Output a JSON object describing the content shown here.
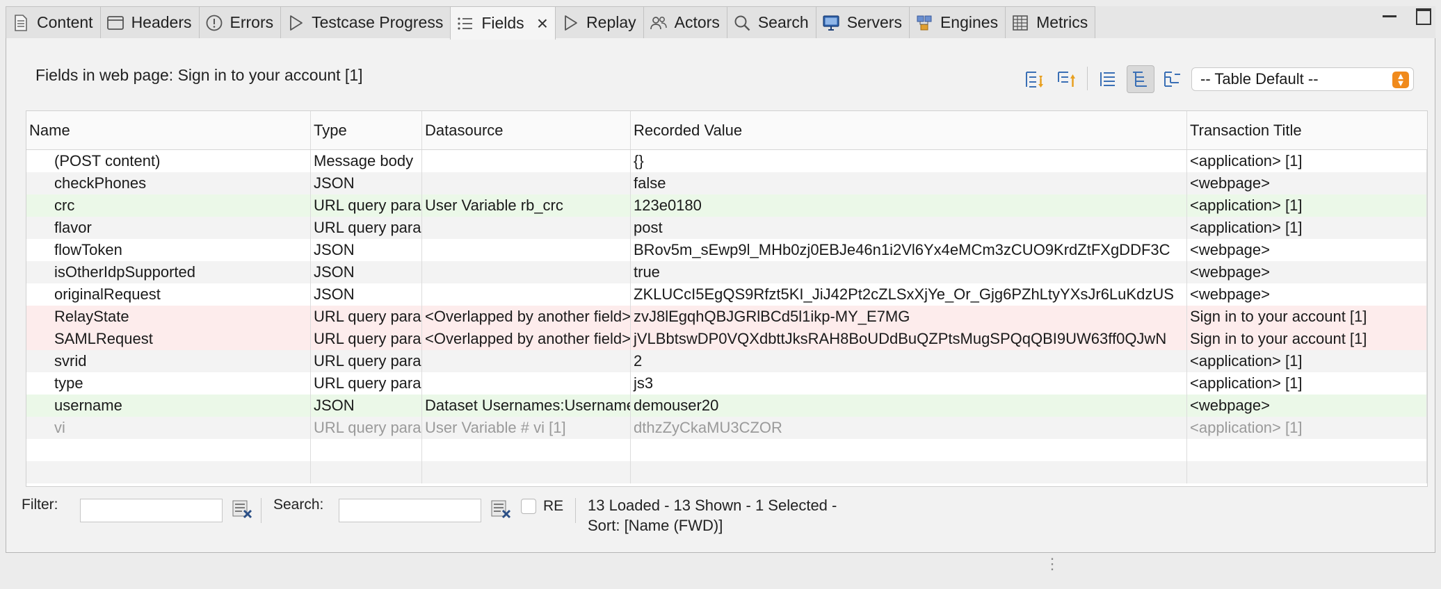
{
  "tabs": [
    {
      "label": "Content",
      "icon": "document-icon",
      "active": false
    },
    {
      "label": "Headers",
      "icon": "window-icon",
      "active": false
    },
    {
      "label": "Errors",
      "icon": "error-circle-icon",
      "active": false
    },
    {
      "label": "Testcase Progress",
      "icon": "play-icon",
      "active": false
    },
    {
      "label": "Fields",
      "icon": "list-icon",
      "active": true
    },
    {
      "label": "Replay",
      "icon": "play-icon",
      "active": false
    },
    {
      "label": "Actors",
      "icon": "users-icon",
      "active": false
    },
    {
      "label": "Search",
      "icon": "search-icon",
      "active": false
    },
    {
      "label": "Servers",
      "icon": "monitor-icon",
      "active": false
    },
    {
      "label": "Engines",
      "icon": "engines-icon",
      "active": false
    },
    {
      "label": "Metrics",
      "icon": "grid-icon",
      "active": false
    }
  ],
  "panel": {
    "title": "Fields in web page: Sign in to your account [1]",
    "view_select": "-- Table Default --"
  },
  "table": {
    "columns": [
      "Name",
      "Type",
      "Datasource",
      "Recorded Value",
      "Transaction Title"
    ],
    "rows": [
      {
        "name": "(POST content)",
        "type": "Message body",
        "datasource": "",
        "value": "{}",
        "title": "<application> [1]",
        "style": "white"
      },
      {
        "name": "checkPhones",
        "type": "JSON",
        "datasource": "",
        "value": "false",
        "title": "<webpage>",
        "style": "gray"
      },
      {
        "name": "crc",
        "type": "URL query parameter",
        "datasource": "User Variable rb_crc",
        "value": "123e0180",
        "title": "<application> [1]",
        "style": "green"
      },
      {
        "name": "flavor",
        "type": "URL query parameter",
        "datasource": "",
        "value": "post",
        "title": "<application> [1]",
        "style": "gray"
      },
      {
        "name": "flowToken",
        "type": "JSON",
        "datasource": "",
        "value": "BRov5m_sEwp9l_MHb0zj0EBJe46n1i2Vl6Yx4eMCm3zCUO9KrdZtFXgDDF3C",
        "title": "<webpage>",
        "style": "white"
      },
      {
        "name": "isOtherIdpSupported",
        "type": "JSON",
        "datasource": "",
        "value": "true",
        "title": "<webpage>",
        "style": "gray"
      },
      {
        "name": "originalRequest",
        "type": "JSON",
        "datasource": "",
        "value": "ZKLUCcI5EgQS9Rfzt5KI_JiJ42Pt2cZLSxXjYe_Or_Gjg6PZhLtyYXsJr6LuKdzUS",
        "title": "<webpage>",
        "style": "white"
      },
      {
        "name": "RelayState",
        "type": "URL query parameter",
        "datasource": "<Overlapped by another field>",
        "value": "zvJ8lEgqhQBJGRlBCd5l1ikp-MY_E7MG",
        "title": "Sign in to your account [1]",
        "style": "red"
      },
      {
        "name": "SAMLRequest",
        "type": "URL query parameter",
        "datasource": "<Overlapped by another field>",
        "value": "jVLBbtswDP0VQXdbttJksRAH8BoUDdBuQZPtsMugSPQqQBI9UW63ff0QJwN",
        "title": "Sign in to your account [1]",
        "style": "red"
      },
      {
        "name": "svrid",
        "type": "URL query parameter",
        "datasource": "",
        "value": "2",
        "title": "<application> [1]",
        "style": "gray"
      },
      {
        "name": "type",
        "type": "URL query parameter",
        "datasource": "",
        "value": "js3",
        "title": "<application> [1]",
        "style": "white"
      },
      {
        "name": "username",
        "type": "JSON",
        "datasource": "Dataset Usernames:Username",
        "value": "demouser20",
        "title": "<webpage>",
        "style": "green"
      },
      {
        "name": "vi",
        "type": "URL query parameter",
        "datasource": "User Variable # vi [1]",
        "value": "dthzZyCkaMU3CZOR",
        "title": "<application> [1]",
        "style": "dim"
      }
    ]
  },
  "footer": {
    "filter_label": "Filter:",
    "filter_value": "",
    "search_label": "Search:",
    "search_value": "",
    "re_label": "RE",
    "status_line1": "13 Loaded - 13 Shown - 1 Selected -",
    "status_line2": "Sort: [Name (FWD)]"
  }
}
